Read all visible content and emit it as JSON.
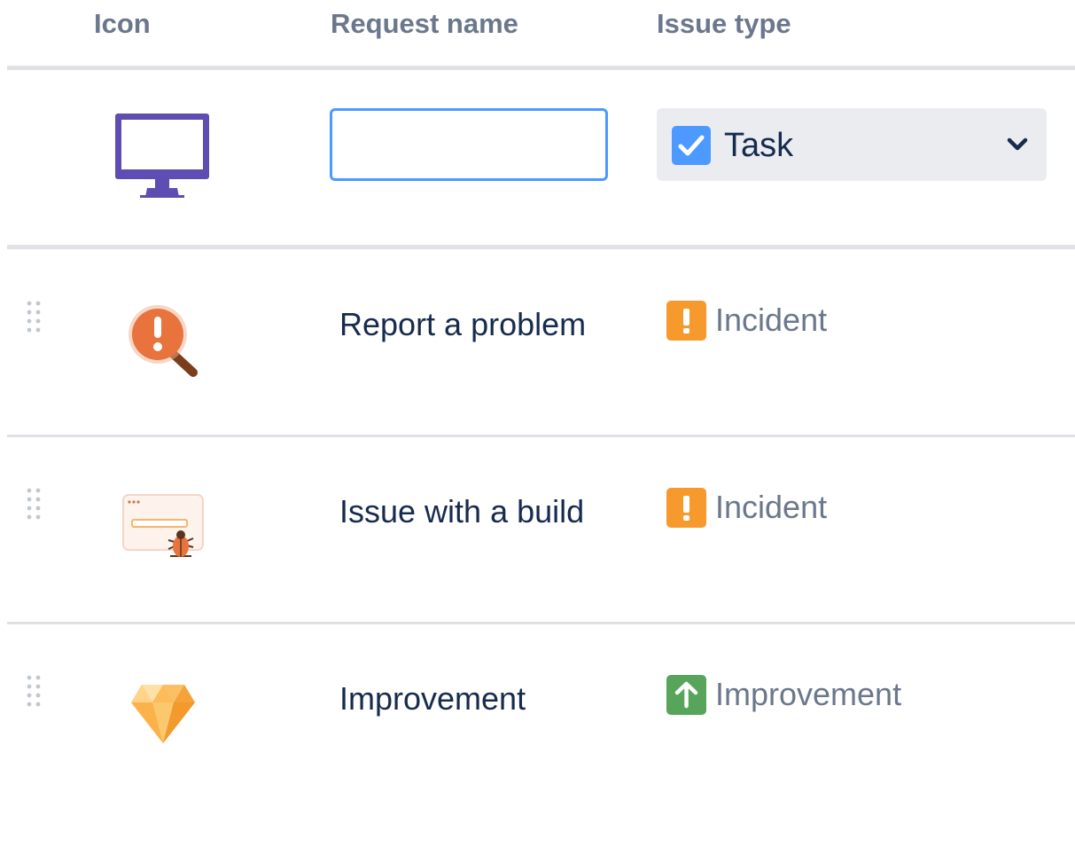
{
  "header": {
    "icon_col": "Icon",
    "name_col": "Request name",
    "type_col": "Issue type"
  },
  "create_row": {
    "icon": "computer-monitor-icon",
    "name_value": "",
    "issue_type": "Task",
    "issue_type_icon": "checkbox-check-icon",
    "issue_type_color": "#4c9aff"
  },
  "rows": [
    {
      "name": "Report a problem",
      "icon": "search-warning-icon",
      "issue_type": "Incident",
      "issue_type_icon": "exclamation-icon",
      "issue_type_color": "#f79a2e"
    },
    {
      "name": "Issue with a build",
      "icon": "browser-bug-icon",
      "issue_type": "Incident",
      "issue_type_icon": "exclamation-icon",
      "issue_type_color": "#f79a2e"
    },
    {
      "name": "Improvement",
      "icon": "diamond-gem-icon",
      "issue_type": "Improvement",
      "issue_type_icon": "arrow-up-icon",
      "issue_type_color": "#57a55a"
    }
  ],
  "colors": {
    "header_text": "#6b778c",
    "primary_text": "#172b4d",
    "secondary_text": "#6b778c",
    "focus_border": "#4c9aff",
    "divider": "#dfe1e6"
  }
}
